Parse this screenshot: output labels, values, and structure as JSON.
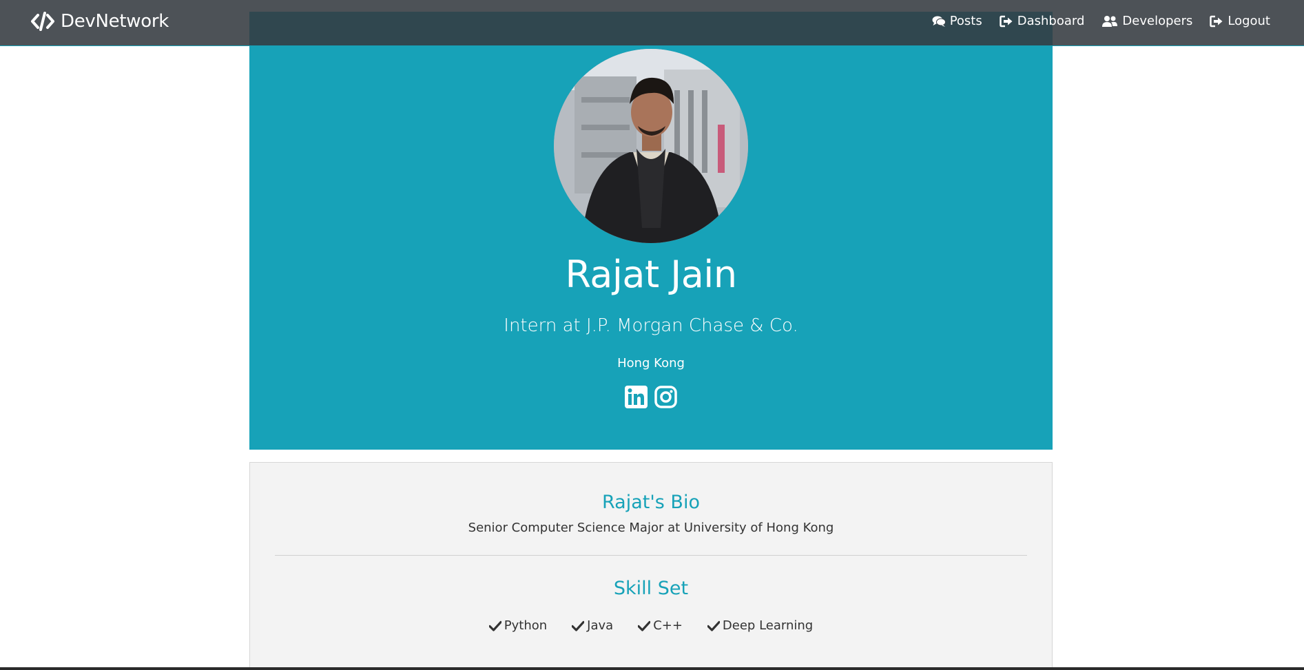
{
  "navbar": {
    "brand": "DevNetwork",
    "links": [
      {
        "label": "Posts",
        "icon": "comments-icon"
      },
      {
        "label": "Dashboard",
        "icon": "sign-out-icon"
      },
      {
        "label": "Developers",
        "icon": "users-icon"
      },
      {
        "label": "Logout",
        "icon": "sign-out-icon"
      }
    ]
  },
  "profile": {
    "name": "Rajat Jain",
    "headline": "Intern at J.P. Morgan Chase & Co.",
    "location": "Hong Kong",
    "socials": [
      "linkedin-icon",
      "instagram-icon"
    ]
  },
  "about": {
    "bio_title": "Rajat's Bio",
    "bio": "Senior Computer Science Major at University of Hong Kong",
    "skills_title": "Skill Set",
    "skills": [
      "Python",
      "Java",
      "C++",
      "Deep Learning"
    ]
  },
  "colors": {
    "accent": "#17a2b8",
    "navbar": "#343a40",
    "card_bg": "#f3f3f3"
  }
}
